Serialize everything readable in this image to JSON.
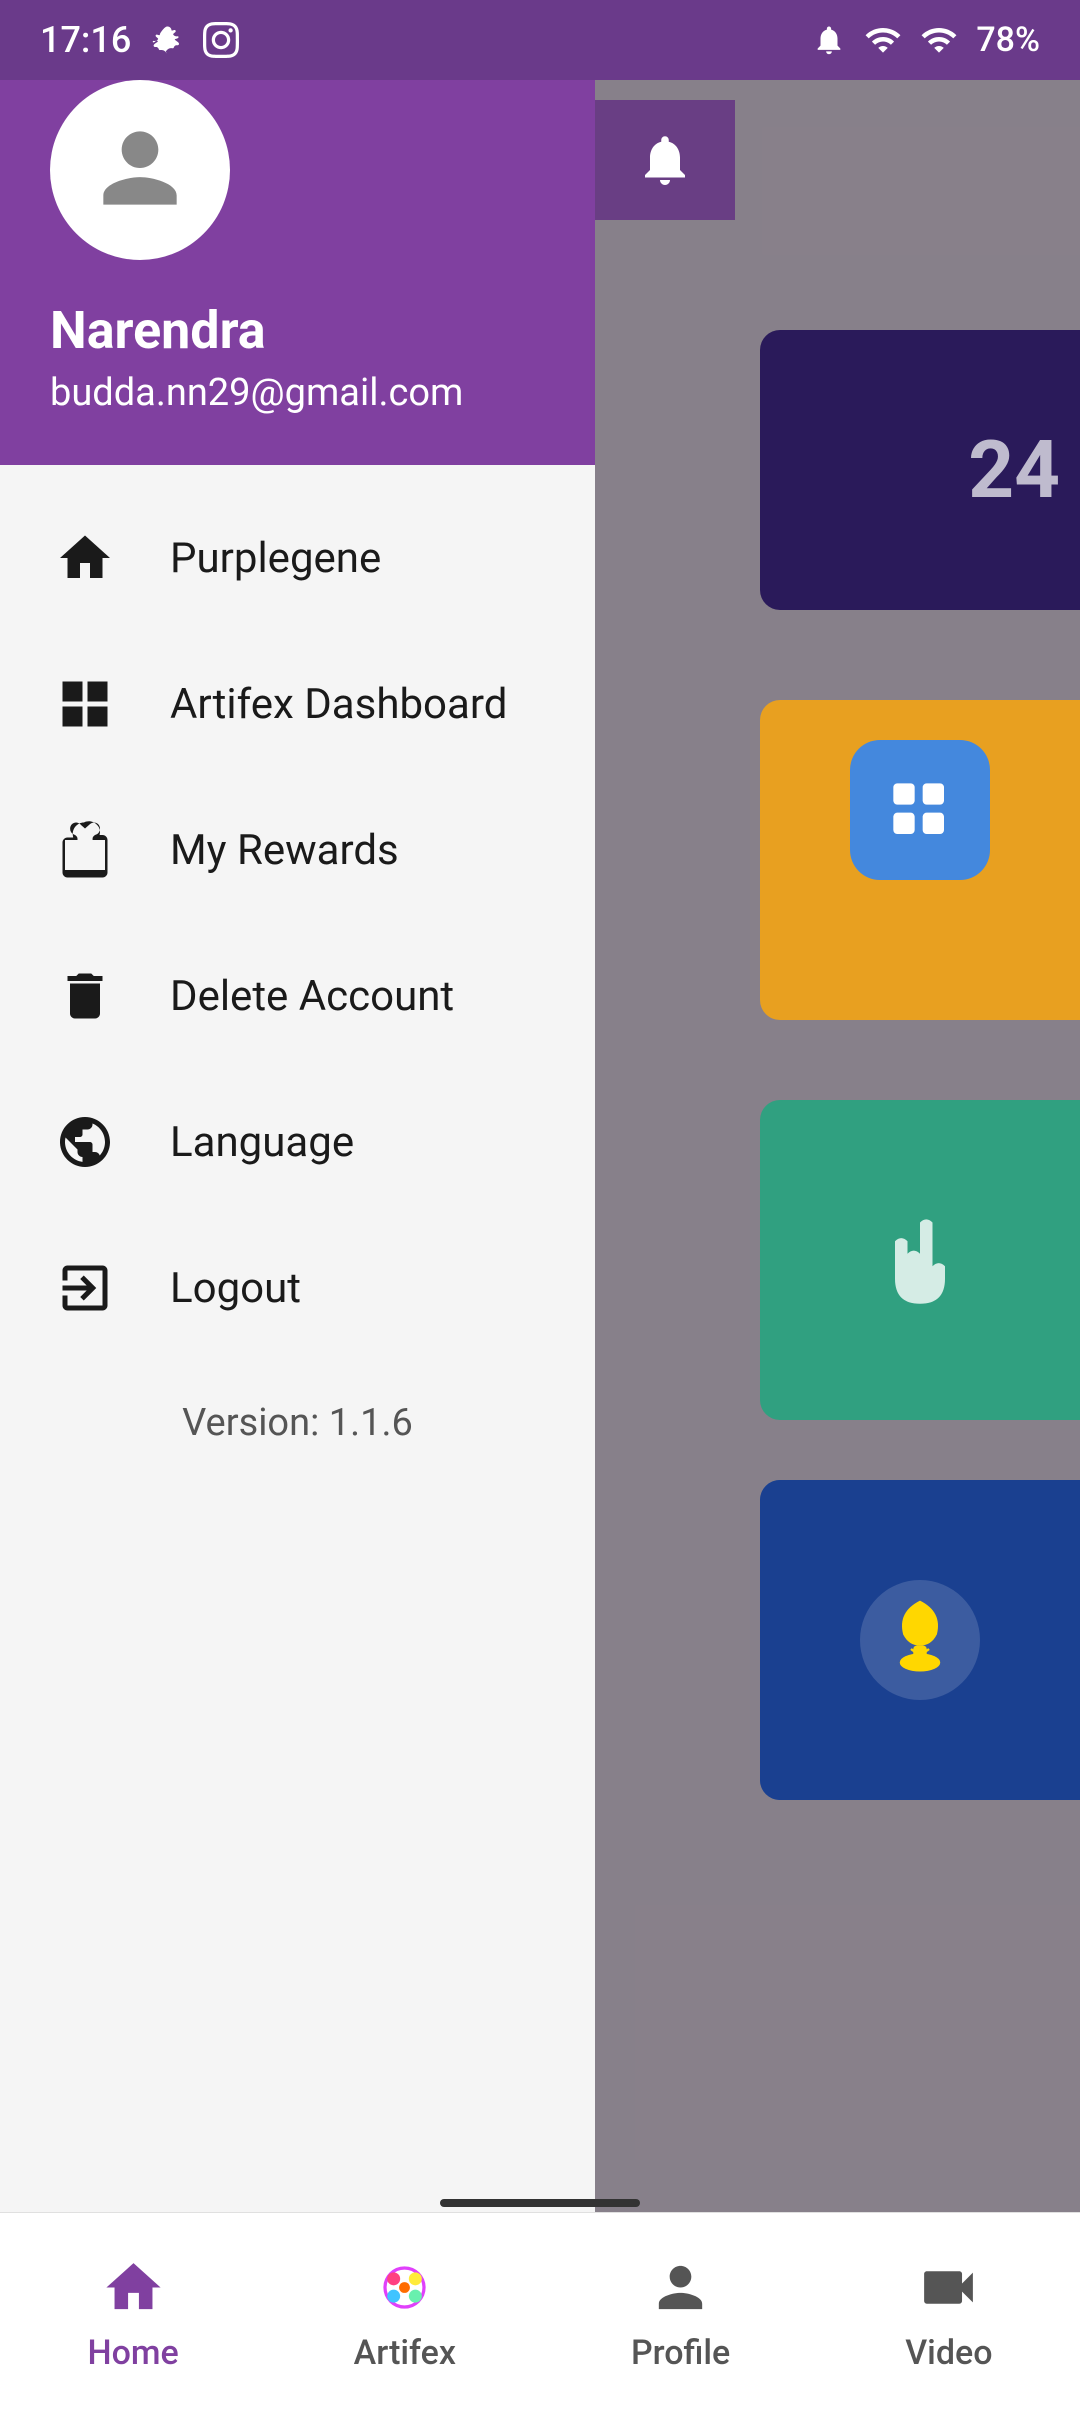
{
  "statusBar": {
    "time": "17:16",
    "battery": "78%"
  },
  "drawer": {
    "user": {
      "name": "Narendra",
      "email": "budda.nn29@gmail.com"
    },
    "menuItems": [
      {
        "id": "purplegene",
        "label": "Purplegene",
        "icon": "home"
      },
      {
        "id": "artifex-dashboard",
        "label": "Artifex Dashboard",
        "icon": "dashboard"
      },
      {
        "id": "my-rewards",
        "label": "My Rewards",
        "icon": "rewards"
      },
      {
        "id": "delete-account",
        "label": "Delete Account",
        "icon": "trash"
      },
      {
        "id": "language",
        "label": "Language",
        "icon": "globe"
      },
      {
        "id": "logout",
        "label": "Logout",
        "icon": "logout"
      }
    ],
    "version": "Version:  1.1.6"
  },
  "bottomNav": {
    "items": [
      {
        "id": "home",
        "label": "Home",
        "active": true
      },
      {
        "id": "artifex",
        "label": "Artifex",
        "active": false
      },
      {
        "id": "profile",
        "label": "Profile",
        "active": false
      },
      {
        "id": "video",
        "label": "Video",
        "active": false
      }
    ]
  }
}
